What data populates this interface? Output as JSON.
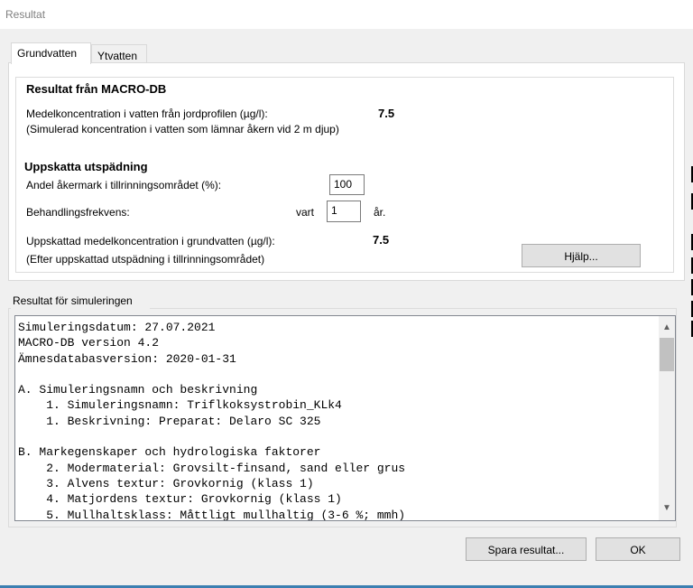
{
  "window": {
    "title": "Resultat"
  },
  "tabs": [
    {
      "label": "Grundvatten"
    },
    {
      "label": "Ytvatten"
    }
  ],
  "macro": {
    "heading": "Resultat från MACRO-DB",
    "conc_label": "Medelkoncentration i vatten från jordprofilen (µg/l):",
    "conc_value": "7.5",
    "conc_note": "(Simulerad koncentration i vatten som lämnar åkern vid 2 m djup)"
  },
  "dilution": {
    "heading": "Uppskatta utspädning",
    "share_label": "Andel åkermark i tillrinningsområdet (%):",
    "share_value": "100",
    "freq_label": "Behandlingsfrekvens:",
    "freq_prefix": "vart",
    "freq_value": "1",
    "freq_suffix": "år.",
    "result_label": "Uppskattad medelkoncentration i grundvatten (µg/l):",
    "result_value": "7.5",
    "result_note": "(Efter uppskattad utspädning i tillrinningsområdet)",
    "help_button": "Hjälp..."
  },
  "simulation": {
    "group_label": "Resultat för simuleringen",
    "text": "Simuleringsdatum: 27.07.2021\nMACRO-DB version 4.2\nÄmnesdatabasversion: 2020-01-31\n\nA. Simuleringsnamn och beskrivning\n    1. Simuleringsnamn: Triflkoksystrobin_KLk4\n    1. Beskrivning: Preparat: Delaro SC 325\n\nB. Markegenskaper och hydrologiska faktorer\n    2. Modermaterial: Grovsilt-finsand, sand eller grus\n    3. Alvens textur: Grovkornig (klass 1)\n    4. Matjordens textur: Grovkornig (klass 1)\n    5. Mullhaltsklass: Måttligt mullhaltig (3-6 %; mmh)"
  },
  "footer": {
    "save_button": "Spara resultat...",
    "ok_button": "OK"
  }
}
